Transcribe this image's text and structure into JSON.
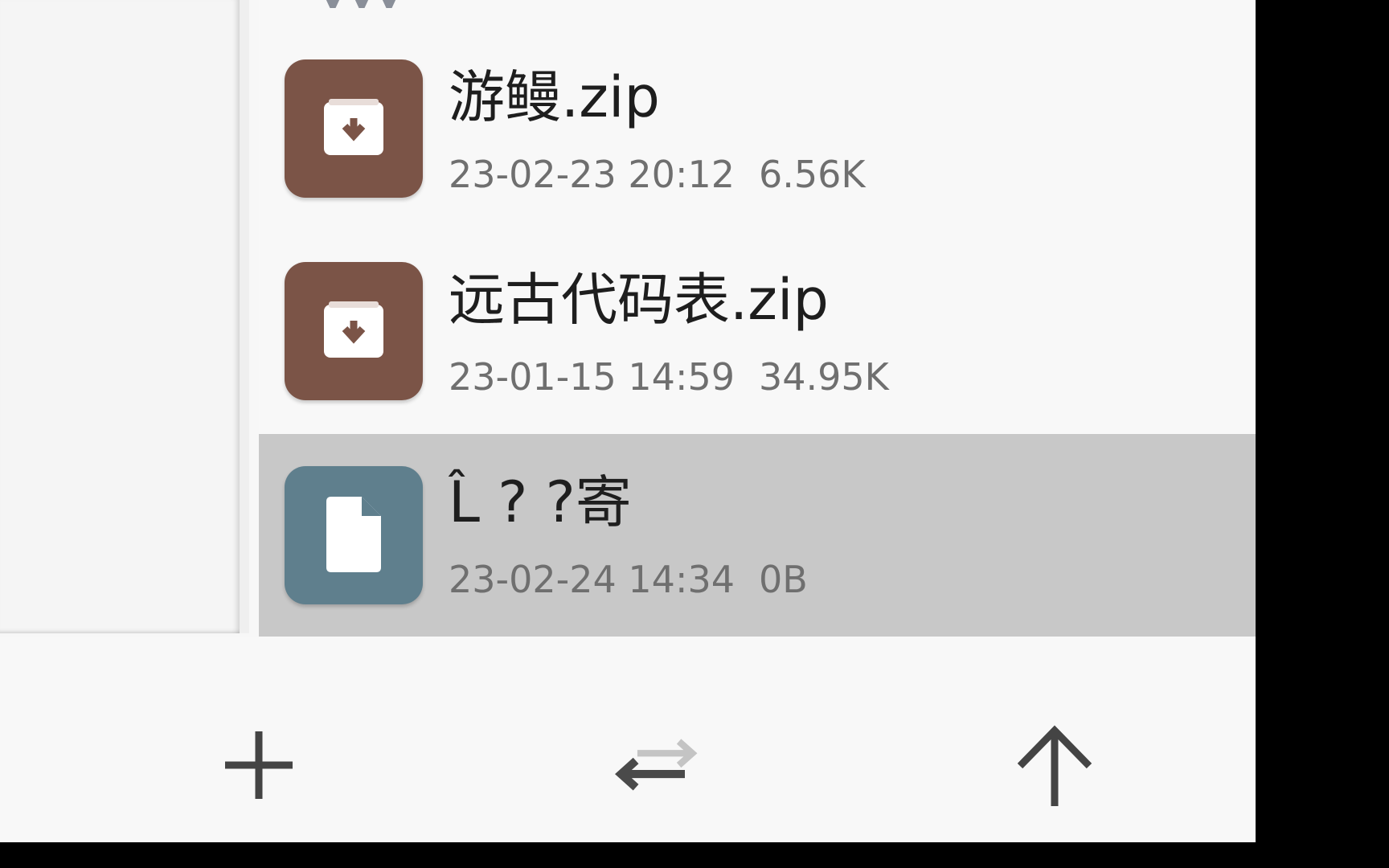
{
  "files": [
    {
      "name": "游鳗.zip",
      "date": "23-02-23 20:12",
      "size": "6.56K",
      "icon": "archive-icon",
      "selected": false
    },
    {
      "name": "远古代码表.zip",
      "date": "23-01-15 14:59",
      "size": "34.95K",
      "icon": "archive-icon",
      "selected": false
    },
    {
      "name": "L̂ ? ?寄",
      "date": "23-02-24 14:34",
      "size": "0B",
      "icon": "file-icon",
      "selected": true
    }
  ],
  "toolbar": {
    "add_icon": "plus-icon",
    "swap_icon": "swap-arrows-icon",
    "up_icon": "arrow-up-icon"
  },
  "colors": {
    "archive": "#7b5447",
    "document": "#5f7f8d",
    "selected_row": "#c8c8c8",
    "background": "#f8f8f8"
  }
}
